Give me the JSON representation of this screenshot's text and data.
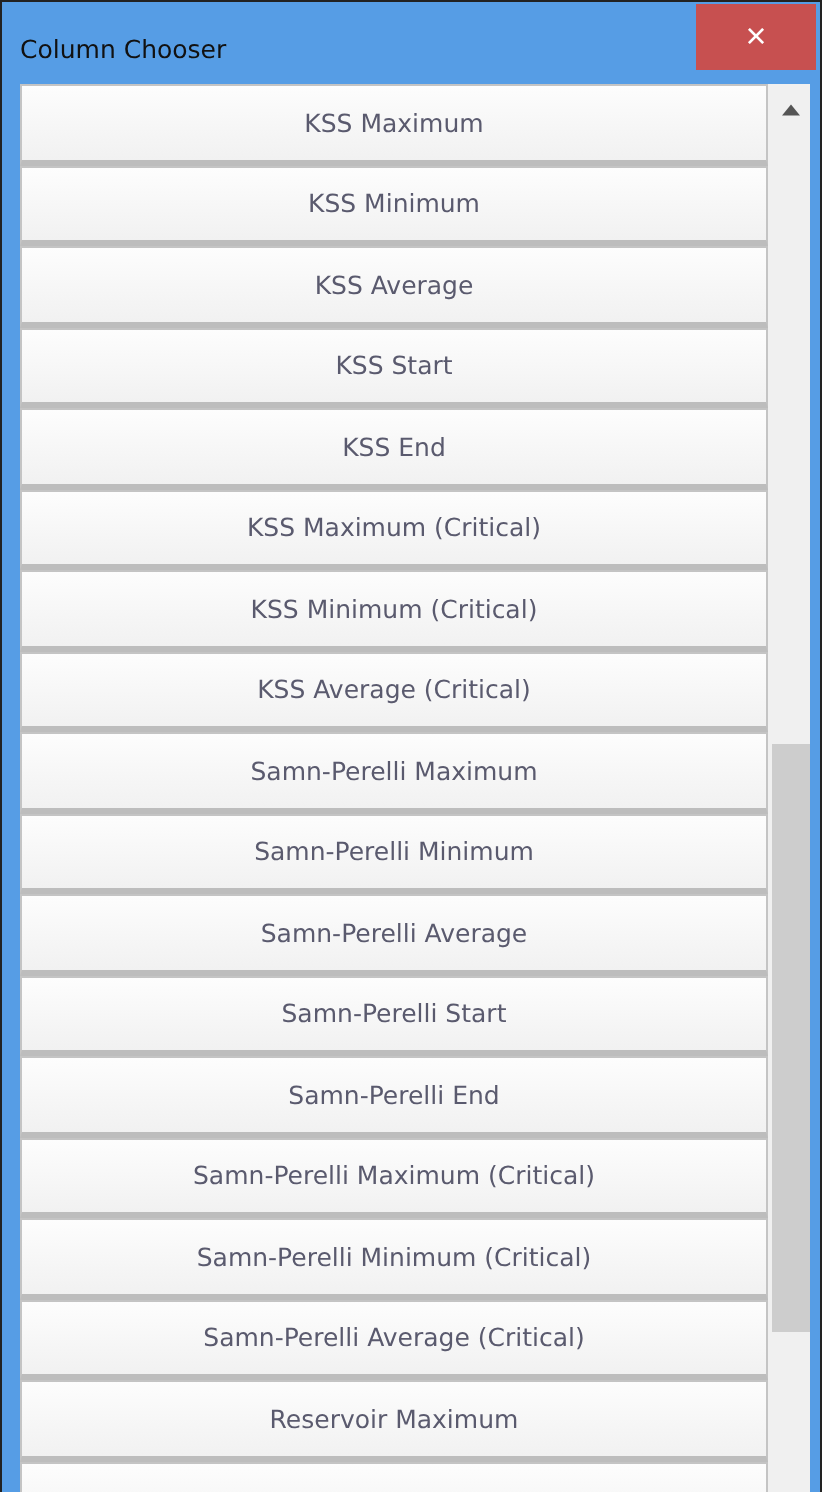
{
  "window": {
    "title": "Column Chooser",
    "close": "×"
  },
  "columns": [
    {
      "label": "KSS Maximum"
    },
    {
      "label": "KSS Minimum"
    },
    {
      "label": "KSS Average"
    },
    {
      "label": "KSS Start"
    },
    {
      "label": "KSS End"
    },
    {
      "label": "KSS Maximum (Critical)"
    },
    {
      "label": "KSS Minimum (Critical)"
    },
    {
      "label": "KSS Average (Critical)"
    },
    {
      "label": "Samn-Perelli Maximum"
    },
    {
      "label": "Samn-Perelli Minimum"
    },
    {
      "label": "Samn-Perelli Average"
    },
    {
      "label": "Samn-Perelli Start"
    },
    {
      "label": "Samn-Perelli End"
    },
    {
      "label": "Samn-Perelli Maximum (Critical)"
    },
    {
      "label": "Samn-Perelli Minimum (Critical)"
    },
    {
      "label": "Samn-Perelli Average (Critical)"
    },
    {
      "label": "Reservoir Maximum"
    }
  ]
}
